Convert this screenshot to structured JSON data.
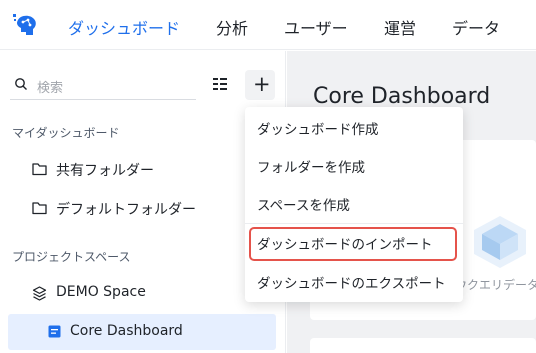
{
  "nav": {
    "tabs": [
      {
        "label": "ダッシュボード",
        "active": true
      },
      {
        "label": "分析"
      },
      {
        "label": "ユーザー"
      },
      {
        "label": "運営"
      },
      {
        "label": "データ"
      }
    ],
    "accent_color": "#1f6feb"
  },
  "sidebar": {
    "search_placeholder": "検索",
    "section_my": "マイダッシュボード",
    "my_items": [
      {
        "label": "共有フォルダー",
        "icon": "folder-icon"
      },
      {
        "label": "デフォルトフォルダー",
        "icon": "folder-icon"
      }
    ],
    "section_project": "プロジェクトスペース",
    "project_items": [
      {
        "label": "DEMO Space",
        "icon": "cube-icon"
      },
      {
        "label": "Core Dashboard",
        "icon": "dashboard-doc-icon",
        "active": true
      }
    ]
  },
  "main": {
    "title": "Core Dashboard",
    "card_caption": "ウクエリデータ"
  },
  "menu": {
    "items": [
      {
        "label": "ダッシュボード作成"
      },
      {
        "label": "フォルダーを作成"
      },
      {
        "label": "スペースを作成"
      },
      {
        "label": "ダッシュボードのインポート",
        "highlighted": true
      },
      {
        "label": "ダッシュボードのエクスポート"
      }
    ],
    "highlight_color": "#e5534b"
  }
}
